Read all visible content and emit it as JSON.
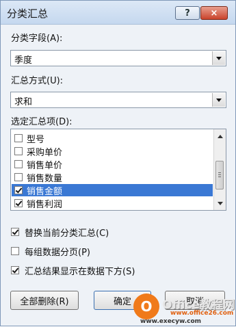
{
  "dialog": {
    "title": "分类汇总",
    "help_label": "?",
    "close_label": "×"
  },
  "group_field": {
    "label": "分类字段(A):",
    "value": "季度"
  },
  "summary_method": {
    "label": "汇总方式(U):",
    "value": "求和"
  },
  "summary_items": {
    "label": "选定汇总项(D):",
    "items": [
      {
        "label": "型号",
        "checked": false,
        "selected": false
      },
      {
        "label": "采购单价",
        "checked": false,
        "selected": false
      },
      {
        "label": "销售单价",
        "checked": false,
        "selected": false
      },
      {
        "label": "销售数量",
        "checked": false,
        "selected": false
      },
      {
        "label": "销售金额",
        "checked": true,
        "selected": true
      },
      {
        "label": "销售利润",
        "checked": true,
        "selected": false
      }
    ]
  },
  "options": {
    "replace_current": {
      "label": "替换当前分类汇总(C)",
      "checked": true
    },
    "page_break": {
      "label": "每组数据分页(P)",
      "checked": false
    },
    "summary_below": {
      "label": "汇总结果显示在数据下方(S)",
      "checked": true
    }
  },
  "buttons": {
    "delete_all": "全部删除(R)",
    "ok": "确定",
    "cancel": "取消"
  },
  "watermark": {
    "logo_glyph": "O",
    "brand": "Office教程网",
    "url1": "www.office26.com",
    "url2": "www.execyw.com"
  },
  "colors": {
    "selection": "#3a78d4",
    "dialog_bg": "#eef2f7",
    "close_button": "#c9432c"
  }
}
